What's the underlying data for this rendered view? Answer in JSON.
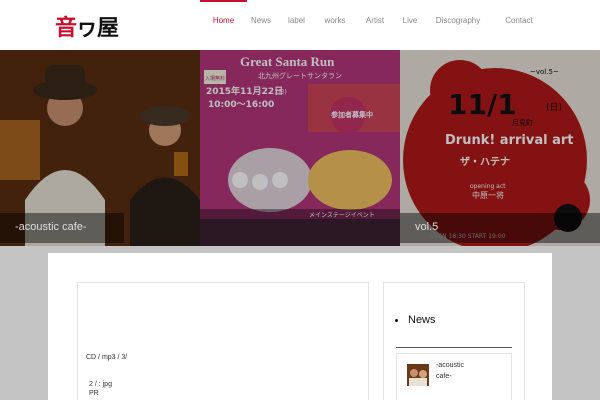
{
  "site": {
    "logo_main": "音",
    "logo_mid": "ヮ",
    "logo_end": "屋"
  },
  "nav": [
    {
      "label": "Home",
      "active": true
    },
    {
      "label": "News",
      "active": false
    },
    {
      "label": "label",
      "active": false
    },
    {
      "label": "works",
      "active": false
    },
    {
      "label": "Artist",
      "active": false
    },
    {
      "label": "Live",
      "active": false
    },
    {
      "label": "Discography",
      "active": false
    },
    {
      "label": "Contact",
      "active": false
    }
  ],
  "slides": [
    {
      "caption": "-acoustic cafe-",
      "color": "#7a3e15"
    },
    {
      "title_en": "Great Santa Run",
      "title_jp": "北九州グレートサンタラン",
      "date": "2015年11月22日",
      "day": "(日)",
      "time": "10:00〜16:00",
      "badge": "参加者募集中",
      "free": "入場無料",
      "stage": "メインステージイベント",
      "color": "#b3367a"
    },
    {
      "caption": "vol.5",
      "date": "11/1",
      "day": "(日)",
      "acts": "Drunk! arrival art",
      "act2": "ザ・ハテナ",
      "opening": "opening act",
      "opening_act": "中原一将",
      "venue": "月見町",
      "vol": "~vol.5~",
      "start": "OPEN 18:30 START 19:00",
      "color": "#8a1a1a"
    }
  ],
  "article": {
    "line1": "CD /  mp3 / 3/",
    "line2": "2 / : jpg",
    "line3": "PR"
  },
  "sidebar": {
    "title": "News",
    "item_text_1": "-acoustic",
    "item_text_2": "cafe-"
  },
  "colors": {
    "accent": "#c8102e",
    "background": "#c4c4c4"
  }
}
